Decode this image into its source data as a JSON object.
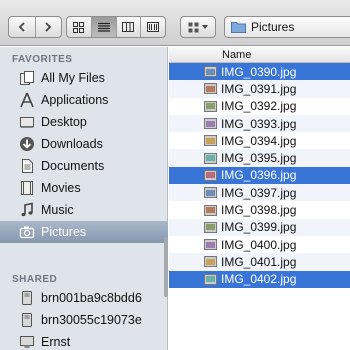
{
  "toolbar": {
    "back_icon": "chevron-left-icon",
    "forward_icon": "chevron-right-icon",
    "views": [
      "icon-view-icon",
      "list-view-icon",
      "column-view-icon",
      "coverflow-view-icon"
    ],
    "active_view": "list-view-icon",
    "arrange_icon": "arrange-grid-icon",
    "path_label": "Pictures"
  },
  "sidebar": {
    "favorites_heading": "FAVORITES",
    "favorites": [
      {
        "label": "All My Files",
        "icon": "all-files-icon"
      },
      {
        "label": "Applications",
        "icon": "applications-icon"
      },
      {
        "label": "Desktop",
        "icon": "desktop-icon"
      },
      {
        "label": "Downloads",
        "icon": "downloads-icon"
      },
      {
        "label": "Documents",
        "icon": "documents-icon"
      },
      {
        "label": "Movies",
        "icon": "movies-icon"
      },
      {
        "label": "Music",
        "icon": "music-icon"
      },
      {
        "label": "Pictures",
        "icon": "camera-icon",
        "selected": true
      }
    ],
    "shared_heading": "SHARED",
    "shared": [
      {
        "label": "brn001ba9c8bdd6",
        "icon": "network-computer-icon"
      },
      {
        "label": "brn30055c19073e",
        "icon": "network-computer-icon"
      },
      {
        "label": "Ernst",
        "icon": "network-computer-icon"
      }
    ]
  },
  "file_list": {
    "column_name": "Name",
    "files": [
      {
        "name": "IMG_0390.jpg",
        "selected": true
      },
      {
        "name": "IMG_0391.jpg",
        "selected": false
      },
      {
        "name": "IMG_0392.jpg",
        "selected": false
      },
      {
        "name": "IMG_0393.jpg",
        "selected": false
      },
      {
        "name": "IMG_0394.jpg",
        "selected": false
      },
      {
        "name": "IMG_0395.jpg",
        "selected": false
      },
      {
        "name": "IMG_0396.jpg",
        "selected": true
      },
      {
        "name": "IMG_0397.jpg",
        "selected": false
      },
      {
        "name": "IMG_0398.jpg",
        "selected": false
      },
      {
        "name": "IMG_0399.jpg",
        "selected": false
      },
      {
        "name": "IMG_0400.jpg",
        "selected": false
      },
      {
        "name": "IMG_0401.jpg",
        "selected": false
      },
      {
        "name": "IMG_0402.jpg",
        "selected": true
      }
    ]
  },
  "colors": {
    "selection": "#3875d7",
    "sidebar_bg": "#dfe4eb",
    "sidebar_selected": "#8797ad"
  }
}
